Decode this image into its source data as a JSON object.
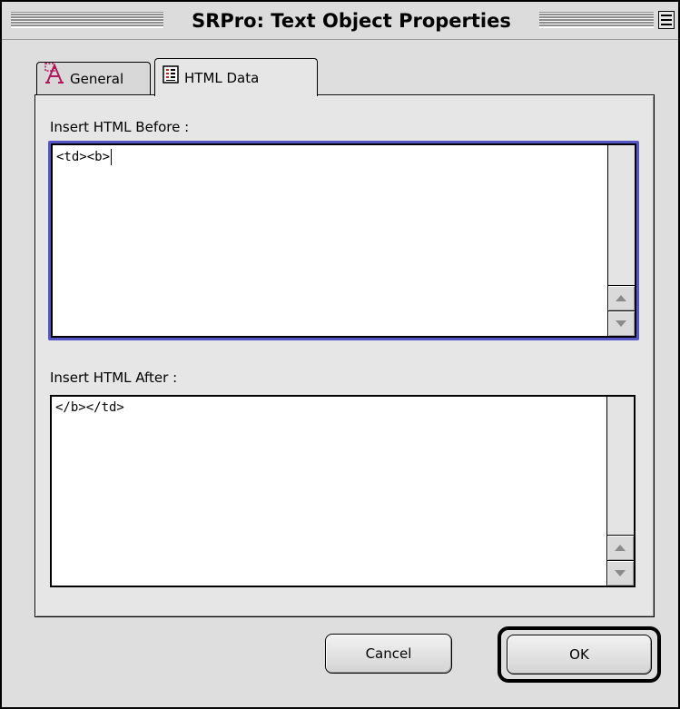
{
  "window": {
    "title": "SRPro: Text Object Properties"
  },
  "tabs": [
    {
      "label": "General",
      "icon": "text-a-icon",
      "selected": false
    },
    {
      "label": "HTML Data",
      "icon": "html-data-icon",
      "selected": true
    }
  ],
  "panel": {
    "before_label": "Insert HTML Before :",
    "before_value": "<td><b>",
    "after_label": "Insert HTML After :",
    "after_value": "</b></td>"
  },
  "buttons": {
    "cancel": "Cancel",
    "ok": "OK"
  },
  "colors": {
    "focus_ring": "#5555c6",
    "general_icon": "#b0185a"
  }
}
